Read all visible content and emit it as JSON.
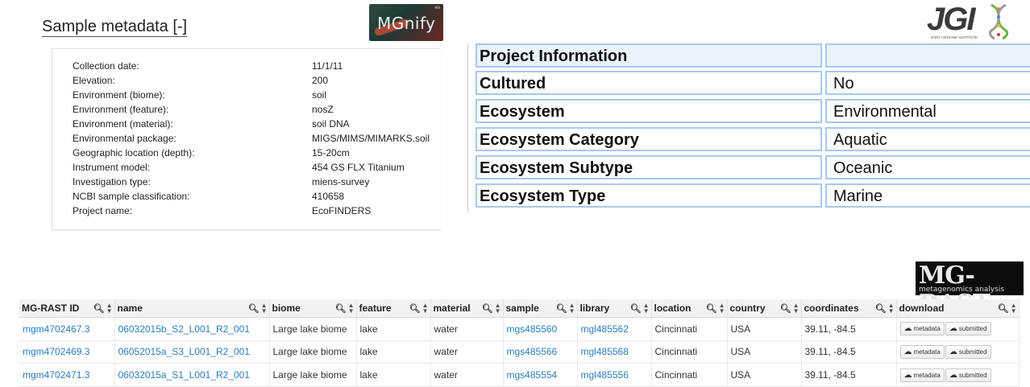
{
  "mgnify": {
    "section_title": "Sample metadata",
    "toggle": "[-]",
    "logo_text": "MGnify",
    "logo_sub": "ebi",
    "rows": [
      {
        "label": "Collection date:",
        "value": "11/1/11"
      },
      {
        "label": "Elevation:",
        "value": "200"
      },
      {
        "label": "Environment (biome):",
        "value": "soil"
      },
      {
        "label": "Environment (feature):",
        "value": "nosZ"
      },
      {
        "label": "Environment (material):",
        "value": "soil DNA"
      },
      {
        "label": "Environmental package:",
        "value": "MIGS/MIMS/MIMARKS.soil"
      },
      {
        "label": "Geographic location (depth):",
        "value": "15-20cm"
      },
      {
        "label": "Instrument model:",
        "value": "454 GS FLX Titanium"
      },
      {
        "label": "Investigation type:",
        "value": "miens-survey"
      },
      {
        "label": "NCBI sample classification:",
        "value": "410658"
      },
      {
        "label": "Project name:",
        "value": "EcoFINDERS"
      }
    ]
  },
  "jgi": {
    "logo_text": "JGI",
    "logo_sub": "JOINT GENOME INSTITUTE",
    "rows": [
      {
        "label": "Project Information",
        "value": ""
      },
      {
        "label": "Cultured",
        "value": "No"
      },
      {
        "label": "Ecosystem",
        "value": "Environmental"
      },
      {
        "label": "Ecosystem Category",
        "value": "Aquatic"
      },
      {
        "label": "Ecosystem Subtype",
        "value": "Oceanic"
      },
      {
        "label": "Ecosystem Type",
        "value": "Marine"
      }
    ]
  },
  "mgrast": {
    "logo_text": "MG-RAST",
    "logo_sub": "metagenomics analysis server",
    "columns": [
      "MG-RAST ID",
      "name",
      "biome",
      "feature",
      "material",
      "sample",
      "library",
      "location",
      "country",
      "coordinates",
      "download"
    ],
    "rows": [
      {
        "id": "mgm4702467.3",
        "name": "06032015b_S2_L001_R2_001",
        "biome": "Large lake biome",
        "feature": "lake",
        "material": "water",
        "sample": "mgs485560",
        "library": "mgl485562",
        "location": "Cincinnati",
        "country": "USA",
        "coordinates": "39.11, -84.5"
      },
      {
        "id": "mgm4702469.3",
        "name": "06052015a_S3_L001_R2_001",
        "biome": "Large lake biome",
        "feature": "lake",
        "material": "water",
        "sample": "mgs485566",
        "library": "mgl485568",
        "location": "Cincinnati",
        "country": "USA",
        "coordinates": "39.11, -84.5"
      },
      {
        "id": "mgm4702471.3",
        "name": "06032015a_S1_L001_R2_001",
        "biome": "Large lake biome",
        "feature": "lake",
        "material": "water",
        "sample": "mgs485554",
        "library": "mgl485556",
        "location": "Cincinnati",
        "country": "USA",
        "coordinates": "39.11, -84.5"
      }
    ],
    "download_buttons": [
      "metadata",
      "submitted"
    ]
  },
  "colors": {
    "link": "#2a7dc1",
    "jgi_border": "#a8c8ef",
    "jgi_header_bg": "#eaf2fb"
  }
}
